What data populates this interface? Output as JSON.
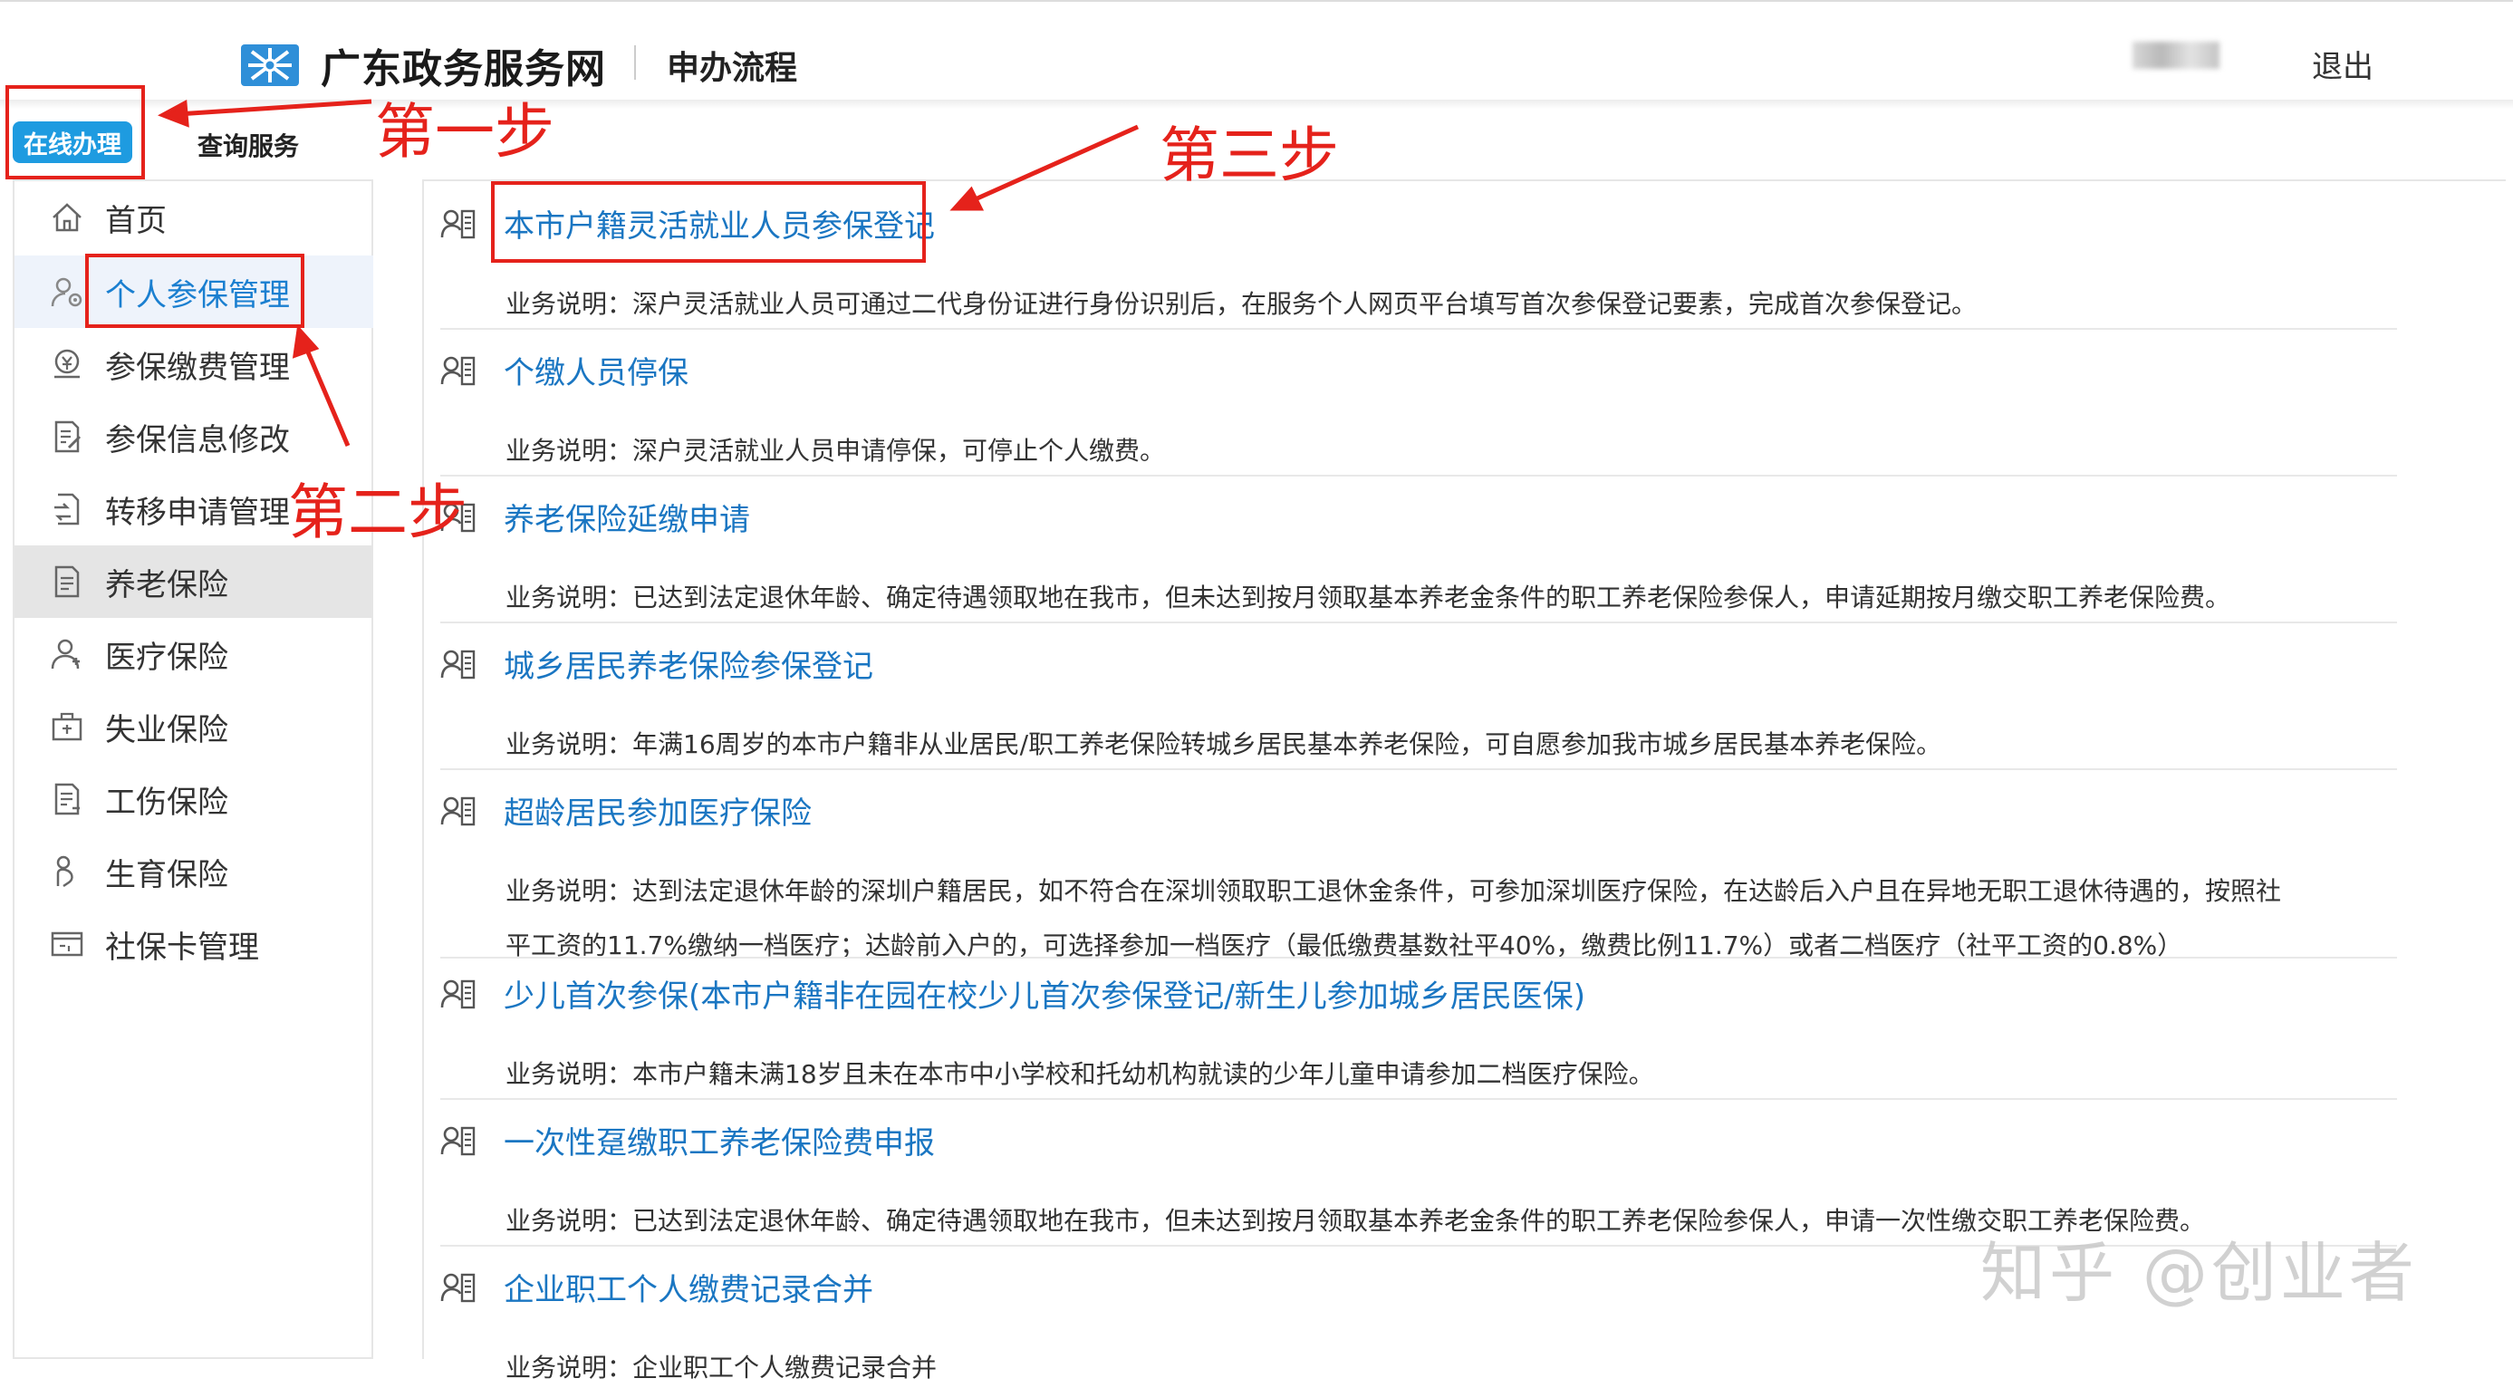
{
  "header": {
    "site_title": "广东政务服务网",
    "page_title": "申办流程",
    "logout_label": "退出",
    "logo_icon": "gd-gov-logo-icon"
  },
  "tabs": {
    "online_label": "在线办理",
    "query_label": "查询服务"
  },
  "sidebar": {
    "items": [
      {
        "label": "首页",
        "icon": "home-icon"
      },
      {
        "label": "个人参保管理",
        "icon": "person-gear-icon"
      },
      {
        "label": "参保缴费管理",
        "icon": "payment-icon"
      },
      {
        "label": "参保信息修改",
        "icon": "edit-doc-icon"
      },
      {
        "label": "转移申请管理",
        "icon": "transfer-icon"
      },
      {
        "label": "养老保险",
        "icon": "pension-doc-icon"
      },
      {
        "label": "医疗保险",
        "icon": "medical-person-icon"
      },
      {
        "label": "失业保险",
        "icon": "briefcase-icon"
      },
      {
        "label": "工伤保险",
        "icon": "injury-doc-icon"
      },
      {
        "label": "生育保险",
        "icon": "maternity-icon"
      },
      {
        "label": "社保卡管理",
        "icon": "si-card-icon"
      }
    ]
  },
  "services": [
    {
      "title": "本市户籍灵活就业人员参保登记",
      "desc": [
        "业务说明：深户灵活就业人员可通过二代身份证进行身份识别后，在服务个人网页平台填写首次参保登记要素，完成首次参保登记。"
      ]
    },
    {
      "title": "个缴人员停保",
      "desc": [
        "业务说明：深户灵活就业人员申请停保，可停止个人缴费。"
      ]
    },
    {
      "title": "养老保险延缴申请",
      "desc": [
        "业务说明：已达到法定退休年龄、确定待遇领取地在我市，但未达到按月领取基本养老金条件的职工养老保险参保人，申请延期按月缴交职工养老保险费。"
      ]
    },
    {
      "title": "城乡居民养老保险参保登记",
      "desc": [
        "业务说明：年满16周岁的本市户籍非从业居民/职工养老保险转城乡居民基本养老保险，可自愿参加我市城乡居民基本养老保险。"
      ]
    },
    {
      "title": "超龄居民参加医疗保险",
      "desc": [
        "业务说明：达到法定退休年龄的深圳户籍居民，如不符合在深圳领取职工退休金条件，可参加深圳医疗保险，在达龄后入户且在异地无职工退休待遇的，按照社",
        "平工资的11.7%缴纳一档医疗；达龄前入户的，可选择参加一档医疗（最低缴费基数社平40%，缴费比例11.7%）或者二档医疗（社平工资的0.8%）"
      ]
    },
    {
      "title": "少儿首次参保(本市户籍非在园在校少儿首次参保登记/新生儿参加城乡居民医保)",
      "desc": [
        "业务说明：本市户籍未满18岁且未在本市中小学校和托幼机构就读的少年儿童申请参加二档医疗保险。"
      ]
    },
    {
      "title": "一次性趸缴职工养老保险费申报",
      "desc": [
        "业务说明：已达到法定退休年龄、确定待遇领取地在我市，但未达到按月领取基本养老金条件的职工养老保险参保人，申请一次性缴交职工养老保险费。"
      ]
    },
    {
      "title": "企业职工个人缴费记录合并",
      "desc": [
        "业务说明：企业职工个人缴费记录合并"
      ]
    }
  ],
  "service_icon": "applicant-form-icon",
  "annotations": {
    "step1": "第一步",
    "step2": "第二步",
    "step3": "第三步",
    "color": "#e5221b"
  },
  "watermark": "知乎 @创业者",
  "colors": {
    "accent": "#1e9be0",
    "link": "#1a76c2",
    "active_bg": "#eef3fb"
  }
}
